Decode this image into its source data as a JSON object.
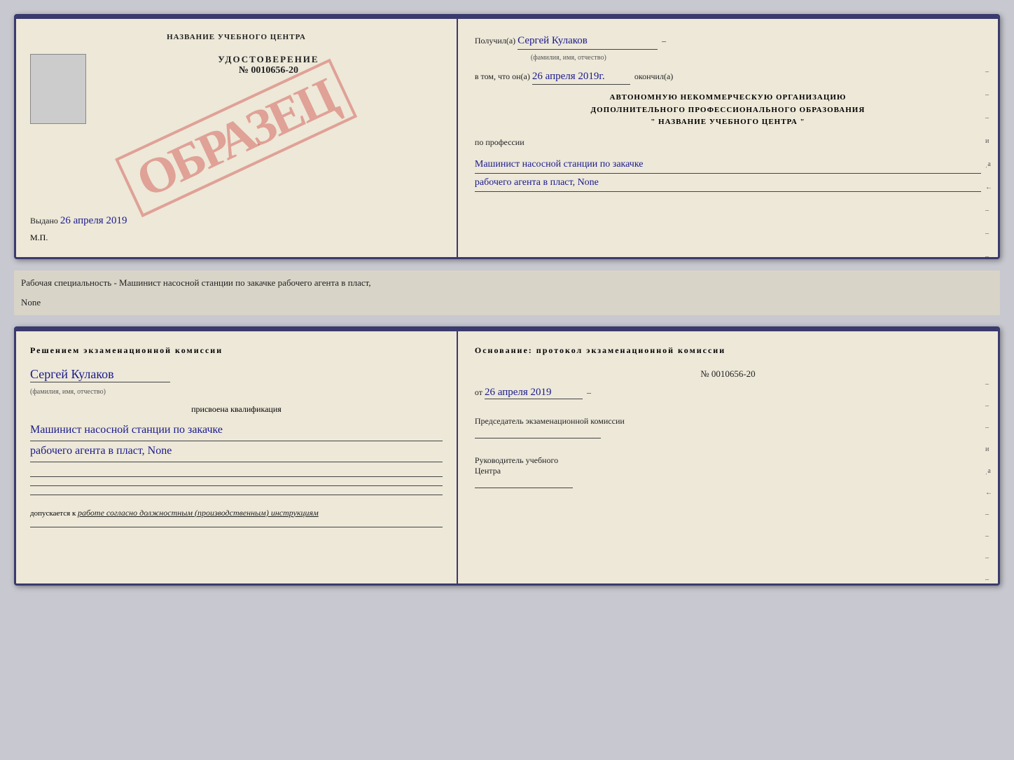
{
  "doc1": {
    "left": {
      "title": "НАЗВАНИЕ УЧЕБНОГО ЦЕНТРА",
      "watermark": "ОБРАЗЕЦ",
      "cert_label": "УДОСТОВЕРЕНИЕ",
      "cert_number": "№ 0010656-20",
      "issued_label": "Выдано",
      "issued_date": "26 апреля 2019",
      "mp_label": "М.П."
    },
    "right": {
      "received_label": "Получил(а)",
      "received_name": "Сергей Кулаков",
      "fio_hint": "(фамилия, имя, отчество)",
      "date_label": "в том, что он(а)",
      "date_value": "26 апреля 2019г.",
      "finished_label": "окончил(а)",
      "org_line1": "АВТОНОМНУЮ НЕКОММЕРЧЕСКУЮ ОРГАНИЗАЦИЮ",
      "org_line2": "ДОПОЛНИТЕЛЬНОГО ПРОФЕССИОНАЛЬНОГО ОБРАЗОВАНИЯ",
      "org_name": "\"   НАЗВАНИЕ УЧЕБНОГО ЦЕНТРА   \"",
      "profession_label": "по профессии",
      "profession_line1": "Машинист насосной станции по закачке",
      "profession_line2": "рабочего агента в пласт, None"
    }
  },
  "caption": "Рабочая специальность - Машинист насосной станции по закачке рабочего агента в пласт,",
  "caption2": "None",
  "doc2": {
    "left": {
      "decision_label": "Решением  экзаменационной  комиссии",
      "person_name": "Сергей Кулаков",
      "fio_hint": "(фамилия, имя, отчество)",
      "qualification_label": "присвоена квалификация",
      "qualification_line1": "Машинист насосной станции по закачке",
      "qualification_line2": "рабочего агента в пласт, None",
      "allowed_label": "допускается к",
      "allowed_text": "работе согласно должностным (производственным) инструкциям"
    },
    "right": {
      "basis_label": "Основание: протокол экзаменационной комиссии",
      "protocol_number": "№  0010656-20",
      "date_label": "от",
      "date_value": "26 апреля 2019",
      "chairman_label": "Председатель экзаменационной комиссии",
      "head_label": "Руководитель учебного",
      "center_label": "Центра"
    }
  }
}
